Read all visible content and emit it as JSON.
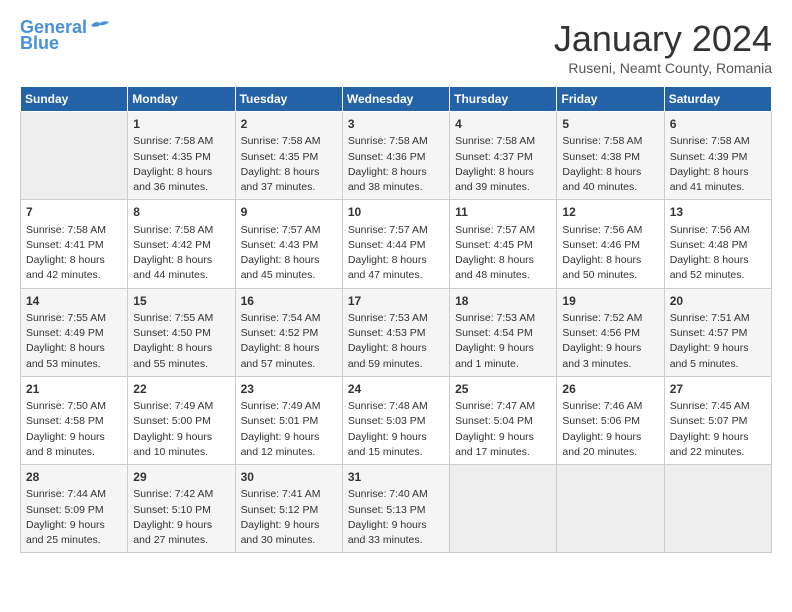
{
  "header": {
    "logo_line1": "General",
    "logo_line2": "Blue",
    "month_title": "January 2024",
    "location": "Ruseni, Neamt County, Romania"
  },
  "weekdays": [
    "Sunday",
    "Monday",
    "Tuesday",
    "Wednesday",
    "Thursday",
    "Friday",
    "Saturday"
  ],
  "rows": [
    [
      {
        "day": "",
        "info": ""
      },
      {
        "day": "1",
        "info": "Sunrise: 7:58 AM\nSunset: 4:35 PM\nDaylight: 8 hours\nand 36 minutes."
      },
      {
        "day": "2",
        "info": "Sunrise: 7:58 AM\nSunset: 4:35 PM\nDaylight: 8 hours\nand 37 minutes."
      },
      {
        "day": "3",
        "info": "Sunrise: 7:58 AM\nSunset: 4:36 PM\nDaylight: 8 hours\nand 38 minutes."
      },
      {
        "day": "4",
        "info": "Sunrise: 7:58 AM\nSunset: 4:37 PM\nDaylight: 8 hours\nand 39 minutes."
      },
      {
        "day": "5",
        "info": "Sunrise: 7:58 AM\nSunset: 4:38 PM\nDaylight: 8 hours\nand 40 minutes."
      },
      {
        "day": "6",
        "info": "Sunrise: 7:58 AM\nSunset: 4:39 PM\nDaylight: 8 hours\nand 41 minutes."
      }
    ],
    [
      {
        "day": "7",
        "info": "Sunrise: 7:58 AM\nSunset: 4:41 PM\nDaylight: 8 hours\nand 42 minutes."
      },
      {
        "day": "8",
        "info": "Sunrise: 7:58 AM\nSunset: 4:42 PM\nDaylight: 8 hours\nand 44 minutes."
      },
      {
        "day": "9",
        "info": "Sunrise: 7:57 AM\nSunset: 4:43 PM\nDaylight: 8 hours\nand 45 minutes."
      },
      {
        "day": "10",
        "info": "Sunrise: 7:57 AM\nSunset: 4:44 PM\nDaylight: 8 hours\nand 47 minutes."
      },
      {
        "day": "11",
        "info": "Sunrise: 7:57 AM\nSunset: 4:45 PM\nDaylight: 8 hours\nand 48 minutes."
      },
      {
        "day": "12",
        "info": "Sunrise: 7:56 AM\nSunset: 4:46 PM\nDaylight: 8 hours\nand 50 minutes."
      },
      {
        "day": "13",
        "info": "Sunrise: 7:56 AM\nSunset: 4:48 PM\nDaylight: 8 hours\nand 52 minutes."
      }
    ],
    [
      {
        "day": "14",
        "info": "Sunrise: 7:55 AM\nSunset: 4:49 PM\nDaylight: 8 hours\nand 53 minutes."
      },
      {
        "day": "15",
        "info": "Sunrise: 7:55 AM\nSunset: 4:50 PM\nDaylight: 8 hours\nand 55 minutes."
      },
      {
        "day": "16",
        "info": "Sunrise: 7:54 AM\nSunset: 4:52 PM\nDaylight: 8 hours\nand 57 minutes."
      },
      {
        "day": "17",
        "info": "Sunrise: 7:53 AM\nSunset: 4:53 PM\nDaylight: 8 hours\nand 59 minutes."
      },
      {
        "day": "18",
        "info": "Sunrise: 7:53 AM\nSunset: 4:54 PM\nDaylight: 9 hours\nand 1 minute."
      },
      {
        "day": "19",
        "info": "Sunrise: 7:52 AM\nSunset: 4:56 PM\nDaylight: 9 hours\nand 3 minutes."
      },
      {
        "day": "20",
        "info": "Sunrise: 7:51 AM\nSunset: 4:57 PM\nDaylight: 9 hours\nand 5 minutes."
      }
    ],
    [
      {
        "day": "21",
        "info": "Sunrise: 7:50 AM\nSunset: 4:58 PM\nDaylight: 9 hours\nand 8 minutes."
      },
      {
        "day": "22",
        "info": "Sunrise: 7:49 AM\nSunset: 5:00 PM\nDaylight: 9 hours\nand 10 minutes."
      },
      {
        "day": "23",
        "info": "Sunrise: 7:49 AM\nSunset: 5:01 PM\nDaylight: 9 hours\nand 12 minutes."
      },
      {
        "day": "24",
        "info": "Sunrise: 7:48 AM\nSunset: 5:03 PM\nDaylight: 9 hours\nand 15 minutes."
      },
      {
        "day": "25",
        "info": "Sunrise: 7:47 AM\nSunset: 5:04 PM\nDaylight: 9 hours\nand 17 minutes."
      },
      {
        "day": "26",
        "info": "Sunrise: 7:46 AM\nSunset: 5:06 PM\nDaylight: 9 hours\nand 20 minutes."
      },
      {
        "day": "27",
        "info": "Sunrise: 7:45 AM\nSunset: 5:07 PM\nDaylight: 9 hours\nand 22 minutes."
      }
    ],
    [
      {
        "day": "28",
        "info": "Sunrise: 7:44 AM\nSunset: 5:09 PM\nDaylight: 9 hours\nand 25 minutes."
      },
      {
        "day": "29",
        "info": "Sunrise: 7:42 AM\nSunset: 5:10 PM\nDaylight: 9 hours\nand 27 minutes."
      },
      {
        "day": "30",
        "info": "Sunrise: 7:41 AM\nSunset: 5:12 PM\nDaylight: 9 hours\nand 30 minutes."
      },
      {
        "day": "31",
        "info": "Sunrise: 7:40 AM\nSunset: 5:13 PM\nDaylight: 9 hours\nand 33 minutes."
      },
      {
        "day": "",
        "info": ""
      },
      {
        "day": "",
        "info": ""
      },
      {
        "day": "",
        "info": ""
      }
    ]
  ]
}
